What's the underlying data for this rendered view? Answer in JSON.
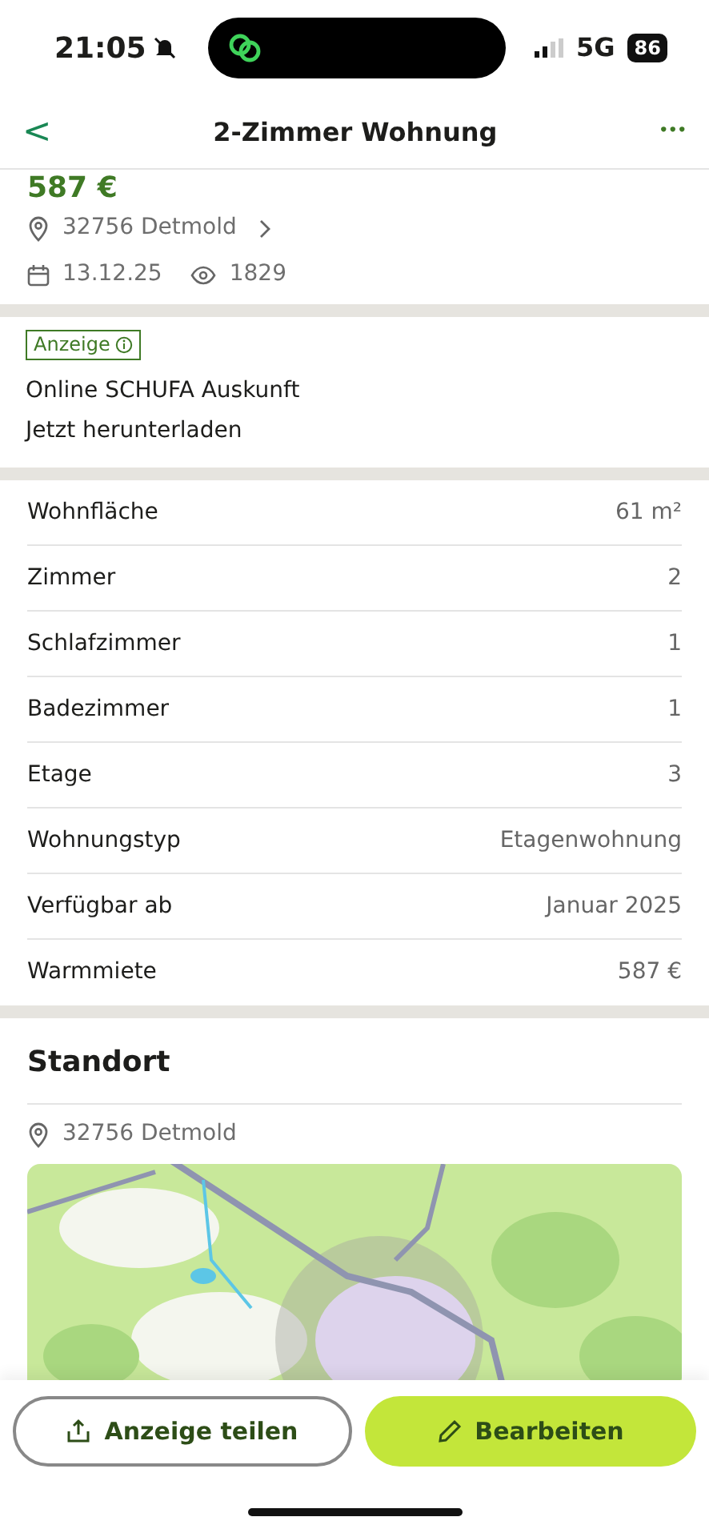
{
  "status_bar": {
    "time": "21:05",
    "network": "5G",
    "battery": "86"
  },
  "header": {
    "back": "<",
    "title": "2-Zimmer Wohnung",
    "more": "•••"
  },
  "listing": {
    "price": "587 €",
    "location": "32756 Detmold",
    "date": "13.12.25",
    "views": "1829"
  },
  "ad": {
    "badge": "Anzeige",
    "title": "Online SCHUFA Auskunft",
    "subtitle": "Jetzt herunterladen"
  },
  "details": [
    {
      "label": "Wohnfläche",
      "value": "61 m²"
    },
    {
      "label": "Zimmer",
      "value": "2"
    },
    {
      "label": "Schlafzimmer",
      "value": "1"
    },
    {
      "label": "Badezimmer",
      "value": "1"
    },
    {
      "label": "Etage",
      "value": "3"
    },
    {
      "label": "Wohnungstyp",
      "value": "Etagenwohnung"
    },
    {
      "label": "Verfügbar ab",
      "value": "Januar 2025"
    },
    {
      "label": "Warmmiete",
      "value": "587 €"
    }
  ],
  "location_section": {
    "title": "Standort",
    "address": "32756 Detmold"
  },
  "actions": [
    {
      "label": "Anzeige teilen",
      "kind": "share"
    },
    {
      "label": "Bearbeiten",
      "kind": "edit"
    }
  ]
}
